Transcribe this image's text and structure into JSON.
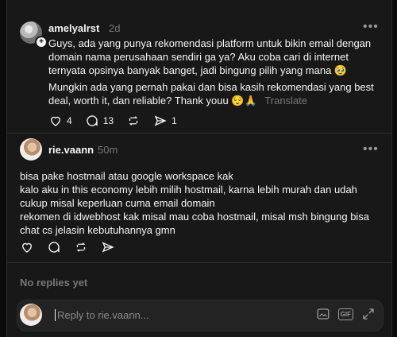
{
  "post1": {
    "username": "amelyalrst",
    "time": "2d",
    "paragraph1": "Guys, ada yang punya rekomendasi platform untuk bikin email dengan domain nama perusahaan sendiri ga ya? Aku coba cari di internet ternyata opsinya banyak banget, jadi bingung pilih yang mana 🥹",
    "paragraph2": "Mungkin ada yang pernah pakai dan bisa kasih rekomendasi yang best deal, worth it, dan reliable? Thank youu 😌🙏",
    "translate": "Translate",
    "likes": "4",
    "comments": "13",
    "shares": "1"
  },
  "reply1": {
    "username": "rie.vaann",
    "time": "50m",
    "lines": [
      "bisa pake hostmail atau google workspace kak",
      "kalo aku in this economy lebih milih hostmail, karna lebih murah dan udah cukup misal keperluan cuma email domain",
      "rekomen di idwebhost kak misal mau coba hostmail, misal msh bingung bisa chat cs jelasin kebutuhannya gmn"
    ]
  },
  "no_replies": "No replies yet",
  "reply_box": {
    "placeholder": "Reply to rie.vaann..."
  },
  "icons": [
    "heart-icon",
    "comment-icon",
    "repost-icon",
    "share-icon",
    "more-icon",
    "gallery-icon",
    "gif-icon",
    "expand-icon"
  ]
}
